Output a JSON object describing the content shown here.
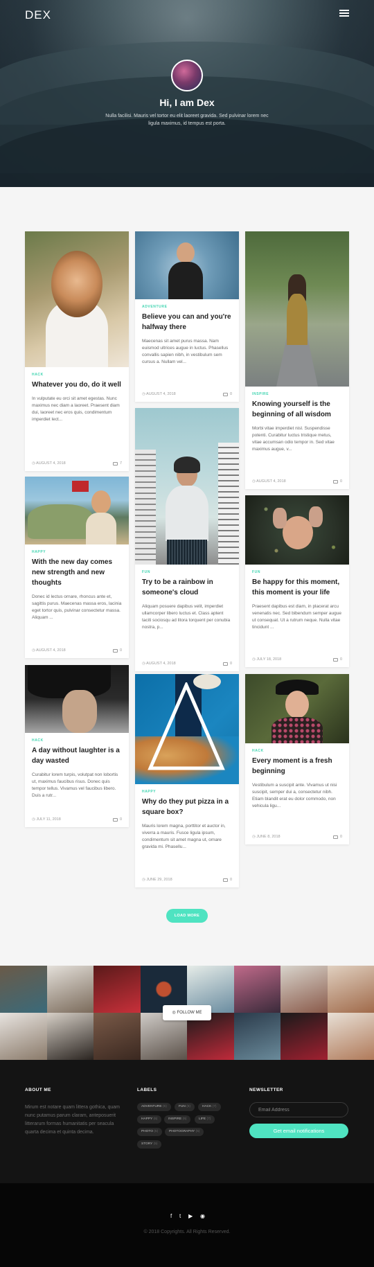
{
  "header": {
    "logo": "DEX"
  },
  "hero": {
    "title": "Hi, I am Dex",
    "subtitle": "Nulla facilisi. Mauris vel tortor eu elit laoreet gravida. Sed pulvinar lorem nec ligula maximus, id tempus est porta."
  },
  "posts": [
    {
      "category": "HACK",
      "title": "Whatever you do, do it well",
      "excerpt": "In vulputate eu orci sit amet egestas. Nunc maximus nec diam a laoreet. Praesent diam dui, laoreet nec eros quis, condimentum imperdiet lect...",
      "date": "AUGUST 4, 2018",
      "comments": "7"
    },
    {
      "category": "HAPPY",
      "title": "With the new day comes new strength and new thoughts",
      "excerpt": "Donec id lectus ornare, rhoncus ante et, sagittis purus. Maecenas massa eros, lacinia eget tortor quis, pulvinar consectetur massa. Aliquam ...",
      "date": "AUGUST 4, 2018",
      "comments": "0"
    },
    {
      "category": "HACK",
      "title": "A day without laughter is a day wasted",
      "excerpt": "Curabitur lorem turpis, volutpat non lobortis ut, maximus faucibus risus. Donec quis tempor tellus. Vivamus vel faucibus libero. Duis a rutr...",
      "date": "JULY 11, 2018",
      "comments": "0"
    },
    {
      "category": "ADVENTURE",
      "title": "Believe you can and you're halfway there",
      "excerpt": "Maecenas sit amet purus massa. Nam euismod ultrices augue in luctus. Phasellus convallis sapien nibh, in vestibulum sem cursus a. Nullam vel...",
      "date": "AUGUST 4, 2018",
      "comments": "0"
    },
    {
      "category": "FUN",
      "title": "Try to be a rainbow in someone's cloud",
      "excerpt": "Aliquam posuere dapibus velit, imperdiet ullamcorper libero luctus et. Class aptent taciti sociosqu ad litora torquent per conubia nostra, p...",
      "date": "AUGUST 4, 2018",
      "comments": "0"
    },
    {
      "category": "HAPPY",
      "title": "Why do they put pizza in a square box?",
      "excerpt": "Mauris lorem magna, porttitor et auctor in, viverra a mauris. Fusce ligula ipsum, condimentum sit amet magna ut, ornare gravida mi. Phasellu...",
      "date": "JUNE 29, 2018",
      "comments": "0"
    },
    {
      "category": "INSPIRE",
      "title": "Knowing yourself is the beginning of all wisdom",
      "excerpt": "Morbi vitae imperdiet nisl. Suspendisse potenti. Curabitur luctus tristique metus, vitae accumsan odio tempor in. Sed vitae maximus augue, v...",
      "date": "AUGUST 4, 2018",
      "comments": "0"
    },
    {
      "category": "FUN",
      "title": "Be happy for this moment, this moment is your life",
      "excerpt": "Praesent dapibus est diam, in placerat arcu venenatis nec. Sed bibendum semper augue ut consequat. Ut a rutrum neque. Nulla vitae tincidunt ...",
      "date": "JULY 18, 2018",
      "comments": "0"
    },
    {
      "category": "HACK",
      "title": "Every moment is a fresh beginning",
      "excerpt": "Vestibulum a suscipit ante. Vivamus ut nisi suscipit, semper dui a, consectetur nibh. Etiam blandit erat eu dolor commodo, non vehicula ligu...",
      "date": "JUNE 8, 2018",
      "comments": "0"
    }
  ],
  "load_more": "LOAD MORE",
  "instagram": {
    "follow_label": "FOLLOW ME"
  },
  "footer": {
    "about_heading": "ABOUT ME",
    "about_text": "Mirum est notare quam littera gothica, quam nunc putamus parum claram, anteposuerit litterarum formas humanitatis per seacula quarta decima et quinta decima.",
    "labels_heading": "LABELS",
    "labels": [
      {
        "name": "ADVENTURE",
        "count": "(5)"
      },
      {
        "name": "FUN",
        "count": "(5)"
      },
      {
        "name": "HACK",
        "count": "(7)"
      },
      {
        "name": "HAPPY",
        "count": "(6)"
      },
      {
        "name": "INSPIRE",
        "count": "(6)"
      },
      {
        "name": "LIFE",
        "count": "(7)"
      },
      {
        "name": "PHOTO",
        "count": "(5)"
      },
      {
        "name": "PHOTOGRAPHY",
        "count": "(5)"
      },
      {
        "name": "STORY",
        "count": "(5)"
      }
    ],
    "newsletter_heading": "NEWSLETTER",
    "email_placeholder": "Email Address",
    "notify_label": "Get email notifications",
    "socials": [
      "f",
      "t",
      "▶",
      "◉"
    ],
    "copyright": "© 2018 Copyrights. All Rights Reserved."
  },
  "colors": {
    "accent": "#4fe3c1",
    "footer_bg": "#141414",
    "bottom_bg": "#060606"
  }
}
